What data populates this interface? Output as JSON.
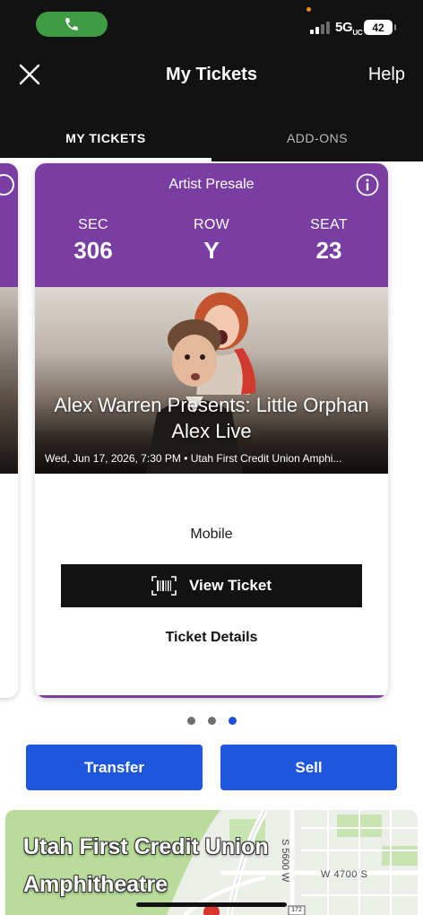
{
  "status_bar": {
    "network": "5G",
    "network_suffix": "UC",
    "battery": "42"
  },
  "header": {
    "title": "My Tickets",
    "help_label": "Help"
  },
  "tabs": [
    {
      "label": "MY TICKETS",
      "active": true
    },
    {
      "label": "ADD-ONS",
      "active": false
    }
  ],
  "ticket": {
    "presale_label": "Artist Presale",
    "section_label": "SEC",
    "section_value": "306",
    "row_label": "ROW",
    "row_value": "Y",
    "seat_label": "SEAT",
    "seat_value": "23",
    "event_name": "Alex Warren Presents: Little Orphan Alex Live",
    "event_date": "Wed, Jun 17, 2026, 7:30 PM • Utah First Credit Union Amphi...",
    "delivery_type": "Mobile",
    "view_ticket_label": "View Ticket",
    "ticket_details_label": "Ticket Details"
  },
  "carousel": {
    "count": 3,
    "active_index": 2
  },
  "actions": {
    "transfer_label": "Transfer",
    "sell_label": "Sell"
  },
  "map": {
    "venue_name_line1": "Utah First Credit Union",
    "venue_name_line2": "Amphitheatre",
    "street_vertical": "S 5600 W",
    "street_horizontal": "W 4700 S",
    "route_shield": "172"
  },
  "colors": {
    "header_bg": "#121212",
    "ticket_purple": "#7a3ea3",
    "action_blue": "#1f56de",
    "call_green": "#3f9b43"
  }
}
